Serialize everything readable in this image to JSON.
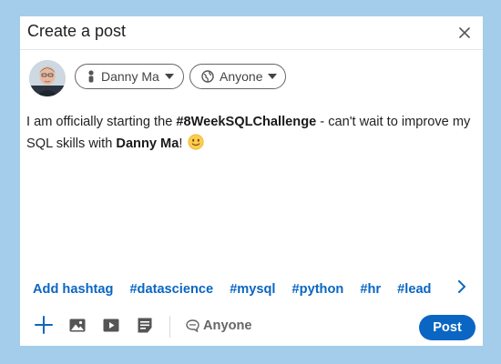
{
  "modal": {
    "title": "Create a post"
  },
  "author": {
    "name_selector_label": "Danny Ma",
    "visibility_selector_label": "Anyone"
  },
  "post": {
    "text_1": "I am officially starting the ",
    "hashtag": "#8WeekSQLChallenge",
    "text_2": " - can't wait to improve my SQL skills with ",
    "mention": "Danny Ma",
    "text_3": "! "
  },
  "hashtags": {
    "add_label": "Add hashtag",
    "items": [
      "#datascience",
      "#mysql",
      "#python",
      "#hr",
      "#lead"
    ]
  },
  "toolbar": {
    "audience_label": "Anyone",
    "post_label": "Post"
  },
  "colors": {
    "accent": "#0a66c2",
    "background": "#a3cdea"
  },
  "icons": [
    "close-icon",
    "person-icon",
    "globe-icon",
    "chevron-down-icon",
    "add-icon",
    "photo-icon",
    "video-icon",
    "document-icon",
    "comment-icon",
    "chevron-right-icon"
  ]
}
